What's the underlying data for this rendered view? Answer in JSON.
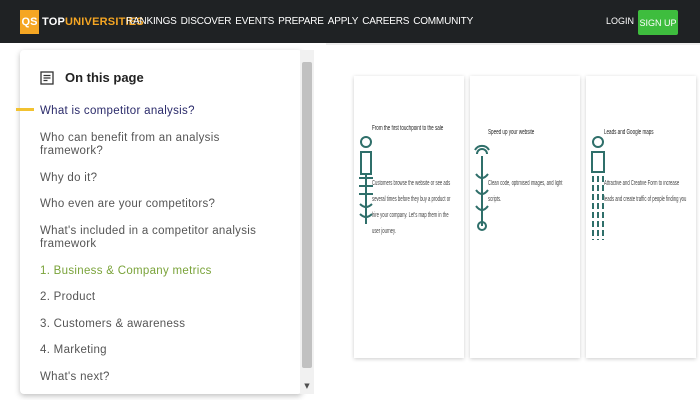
{
  "header": {
    "logo_badge": "QS",
    "logo_top": "TOP",
    "logo_uni": "UNIVERSITIES",
    "nav": [
      "RANKINGS",
      "DISCOVER",
      "EVENTS",
      "PREPARE",
      "APPLY",
      "CAREERS",
      "COMMUNITY"
    ],
    "login": "LOGIN",
    "signup": "SIGN UP"
  },
  "toc": {
    "title": "On this page",
    "icon": "list-document-icon",
    "items": [
      "What is competitor analysis?",
      "Who can benefit from an analysis framework?",
      "Why do it?",
      "Who even are your competitors?",
      "What's included in a competitor analysis framework",
      "1. Business & Company metrics",
      "2. Product",
      "3. Customers & awareness",
      "4. Marketing",
      "What's next?"
    ]
  },
  "cards": [
    {
      "title": "From the first touchpoint to the sale",
      "body": "Customers browse the website or see ads several times before they buy a product or hire your company. Let's map them in the user journey.",
      "icon": "journey-icon"
    },
    {
      "title": "Speed up your website",
      "body": "Clean code, optimised images, and light scripts.",
      "icon": "speed-icon"
    },
    {
      "title": "Leads and Google maps",
      "body": "Attractive and Creative Form to increase leads and create traffic of people finding you",
      "icon": "leads-icon"
    }
  ],
  "colors": {
    "topbar": "#1f2224",
    "logo_accent": "#f5a623",
    "signup": "#3ebd3e",
    "highlight": "#7aa33a",
    "arrow": "#f2c230",
    "icon_teal": "#2f6f6a"
  }
}
